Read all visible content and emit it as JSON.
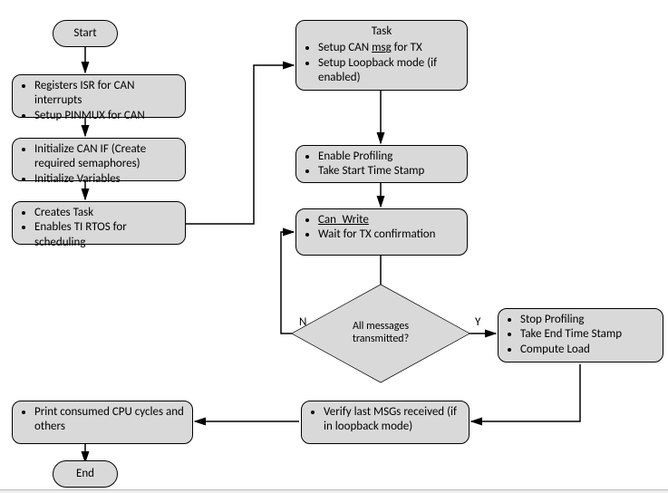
{
  "chart_data": {
    "type": "flowchart",
    "nodes": [
      {
        "id": "start",
        "kind": "terminator",
        "label": "Start"
      },
      {
        "id": "n1",
        "kind": "process",
        "items": [
          "Registers ISR for CAN interrupts",
          "Setup PINMUX for CAN"
        ]
      },
      {
        "id": "n2",
        "kind": "process",
        "items": [
          "Initialize CAN IF (Create required semaphores)",
          "Initialize Variables"
        ]
      },
      {
        "id": "n3",
        "kind": "process",
        "items": [
          "Creates Task",
          "Enables TI RTOS for scheduling"
        ]
      },
      {
        "id": "task",
        "kind": "process",
        "title": "Task",
        "items": [
          "Setup CAN msg for TX",
          "Setup Loopback mode (if enabled)"
        ]
      },
      {
        "id": "n4",
        "kind": "process",
        "items": [
          "Enable Profiling",
          "Take Start Time Stamp"
        ]
      },
      {
        "id": "n5",
        "kind": "process",
        "items": [
          "Can_Write",
          "Wait for TX confirmation"
        ]
      },
      {
        "id": "d1",
        "kind": "decision",
        "text_l1": "All messages",
        "text_l2": "transmitted?",
        "no": "N",
        "yes": "Y"
      },
      {
        "id": "n6",
        "kind": "process",
        "items": [
          "Stop Profiling",
          "Take End Time Stamp",
          "Compute Load"
        ]
      },
      {
        "id": "n7",
        "kind": "process",
        "items": [
          "Verify last MSGs received (if in loopback mode)"
        ]
      },
      {
        "id": "n8",
        "kind": "process",
        "items": [
          "Print consumed CPU cycles and others"
        ]
      },
      {
        "id": "end",
        "kind": "terminator",
        "label": "End"
      }
    ],
    "edges": [
      {
        "from": "start",
        "to": "n1"
      },
      {
        "from": "n1",
        "to": "n2"
      },
      {
        "from": "n2",
        "to": "n3"
      },
      {
        "from": "n3",
        "to": "task"
      },
      {
        "from": "task",
        "to": "n4"
      },
      {
        "from": "n4",
        "to": "n5"
      },
      {
        "from": "n5",
        "to": "d1"
      },
      {
        "from": "d1",
        "to": "n5",
        "label": "N"
      },
      {
        "from": "d1",
        "to": "n6",
        "label": "Y"
      },
      {
        "from": "n6",
        "to": "n7"
      },
      {
        "from": "n7",
        "to": "n8"
      },
      {
        "from": "n8",
        "to": "end"
      }
    ]
  },
  "underline_words": {
    "task_msg": "msg",
    "n5_canwrite": "Can_Write"
  }
}
